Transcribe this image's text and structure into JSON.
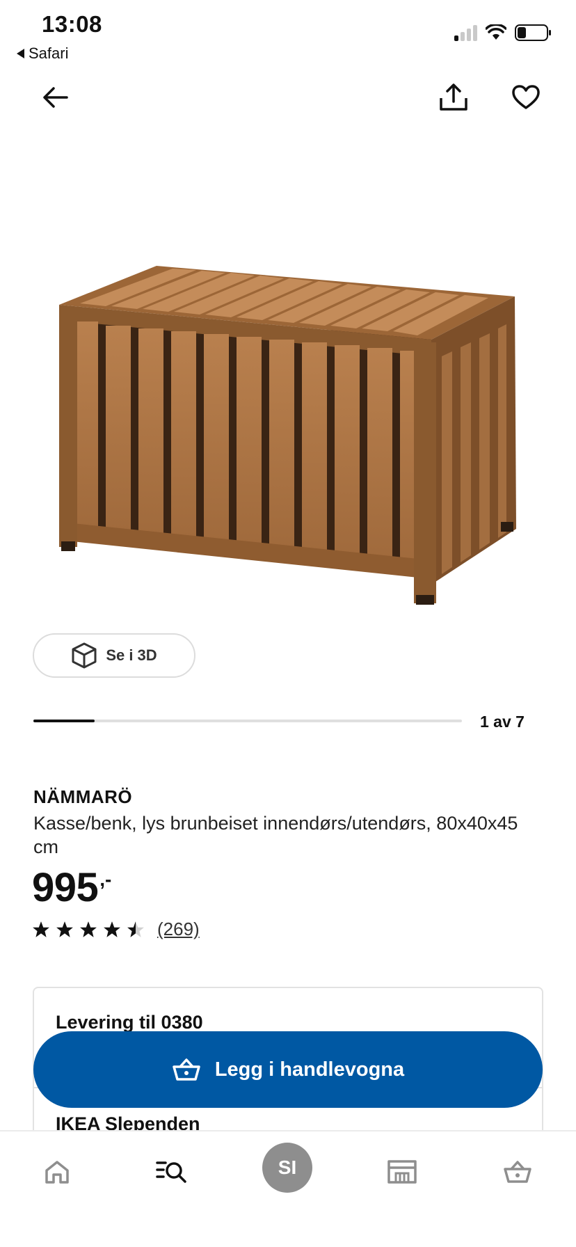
{
  "status_bar": {
    "time": "13:08",
    "back_app": "Safari"
  },
  "nav": {
    "back_icon": "arrow-left-icon",
    "share_icon": "share-icon",
    "favorite_icon": "heart-icon"
  },
  "gallery": {
    "view_3d_label": "Se i 3D",
    "counter": "1 av 7",
    "current_fraction": 0.143
  },
  "product": {
    "name": "NÄMMARÖ",
    "description": "Kasse/benk, lys brunbeiset innendørs/utendørs, 80x40x45 cm",
    "price": "995",
    "price_suffix": ",-",
    "rating": 4.5,
    "review_count": "(269)"
  },
  "availability": {
    "delivery_title": "Levering til 0380",
    "store_title": "IKEA Slependen"
  },
  "cart_button": {
    "label": "Legg i handlevogna"
  },
  "bottom_nav": {
    "items": [
      "home-icon",
      "search-list-icon",
      "profile-avatar",
      "store-icon",
      "cart-icon"
    ],
    "avatar_initials": "SI"
  },
  "colors": {
    "brand_blue": "#0058a3",
    "avatar_gray": "#8e8e8e"
  }
}
